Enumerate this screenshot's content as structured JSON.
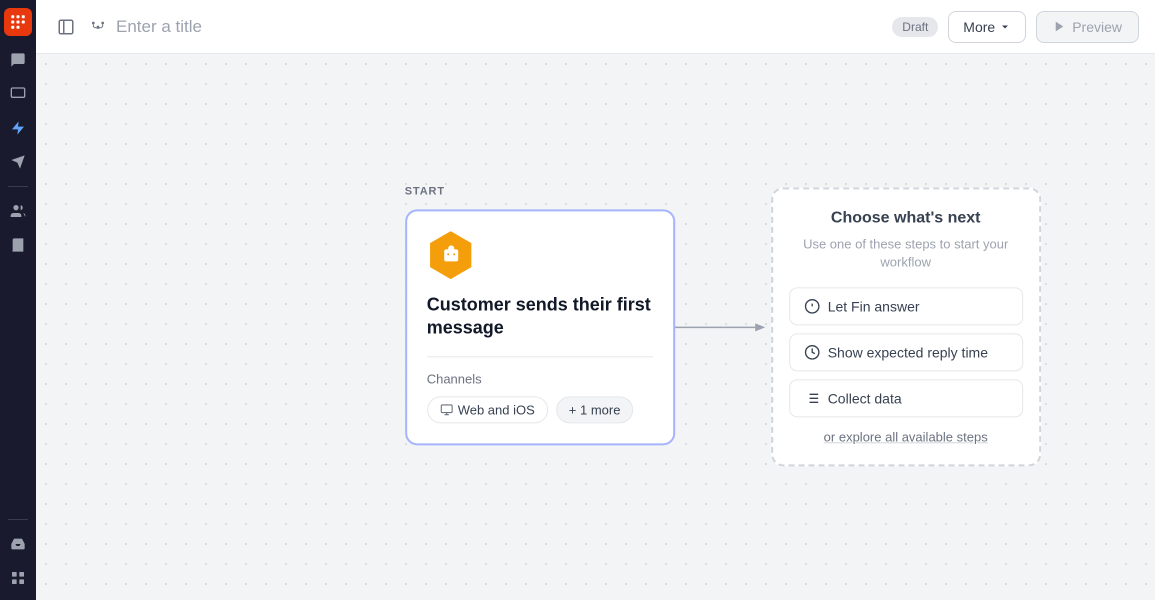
{
  "sidebar": {
    "logo_label": "Intercom",
    "items": [
      {
        "id": "chat",
        "icon": "chat-icon",
        "active": false
      },
      {
        "id": "monitor",
        "icon": "monitor-icon",
        "active": false
      },
      {
        "id": "bolt",
        "icon": "bolt-icon",
        "active": true
      },
      {
        "id": "send",
        "icon": "send-icon",
        "active": false
      },
      {
        "id": "people",
        "icon": "people-icon",
        "active": false
      },
      {
        "id": "book",
        "icon": "book-icon",
        "active": false
      },
      {
        "id": "chart",
        "icon": "chart-icon",
        "active": false
      }
    ],
    "bottom_items": [
      {
        "id": "inbox",
        "icon": "inbox-icon"
      },
      {
        "id": "grid",
        "icon": "grid-icon"
      }
    ]
  },
  "header": {
    "title_placeholder": "Enter a title",
    "draft_label": "Draft",
    "more_label": "More",
    "preview_label": "Preview"
  },
  "workflow": {
    "start_label": "START",
    "start_card": {
      "title": "Customer sends their first message",
      "channels_label": "Channels",
      "channel_tag": "Web and iOS",
      "more_tag": "+ 1 more"
    },
    "choose_node": {
      "title": "Choose what's next",
      "subtitle": "Use one of these steps to start your workflow",
      "steps": [
        {
          "id": "fin",
          "label": "Let Fin answer"
        },
        {
          "id": "reply",
          "label": "Show expected reply time"
        },
        {
          "id": "collect",
          "label": "Collect data"
        }
      ],
      "explore_label": "or explore all available steps"
    }
  }
}
